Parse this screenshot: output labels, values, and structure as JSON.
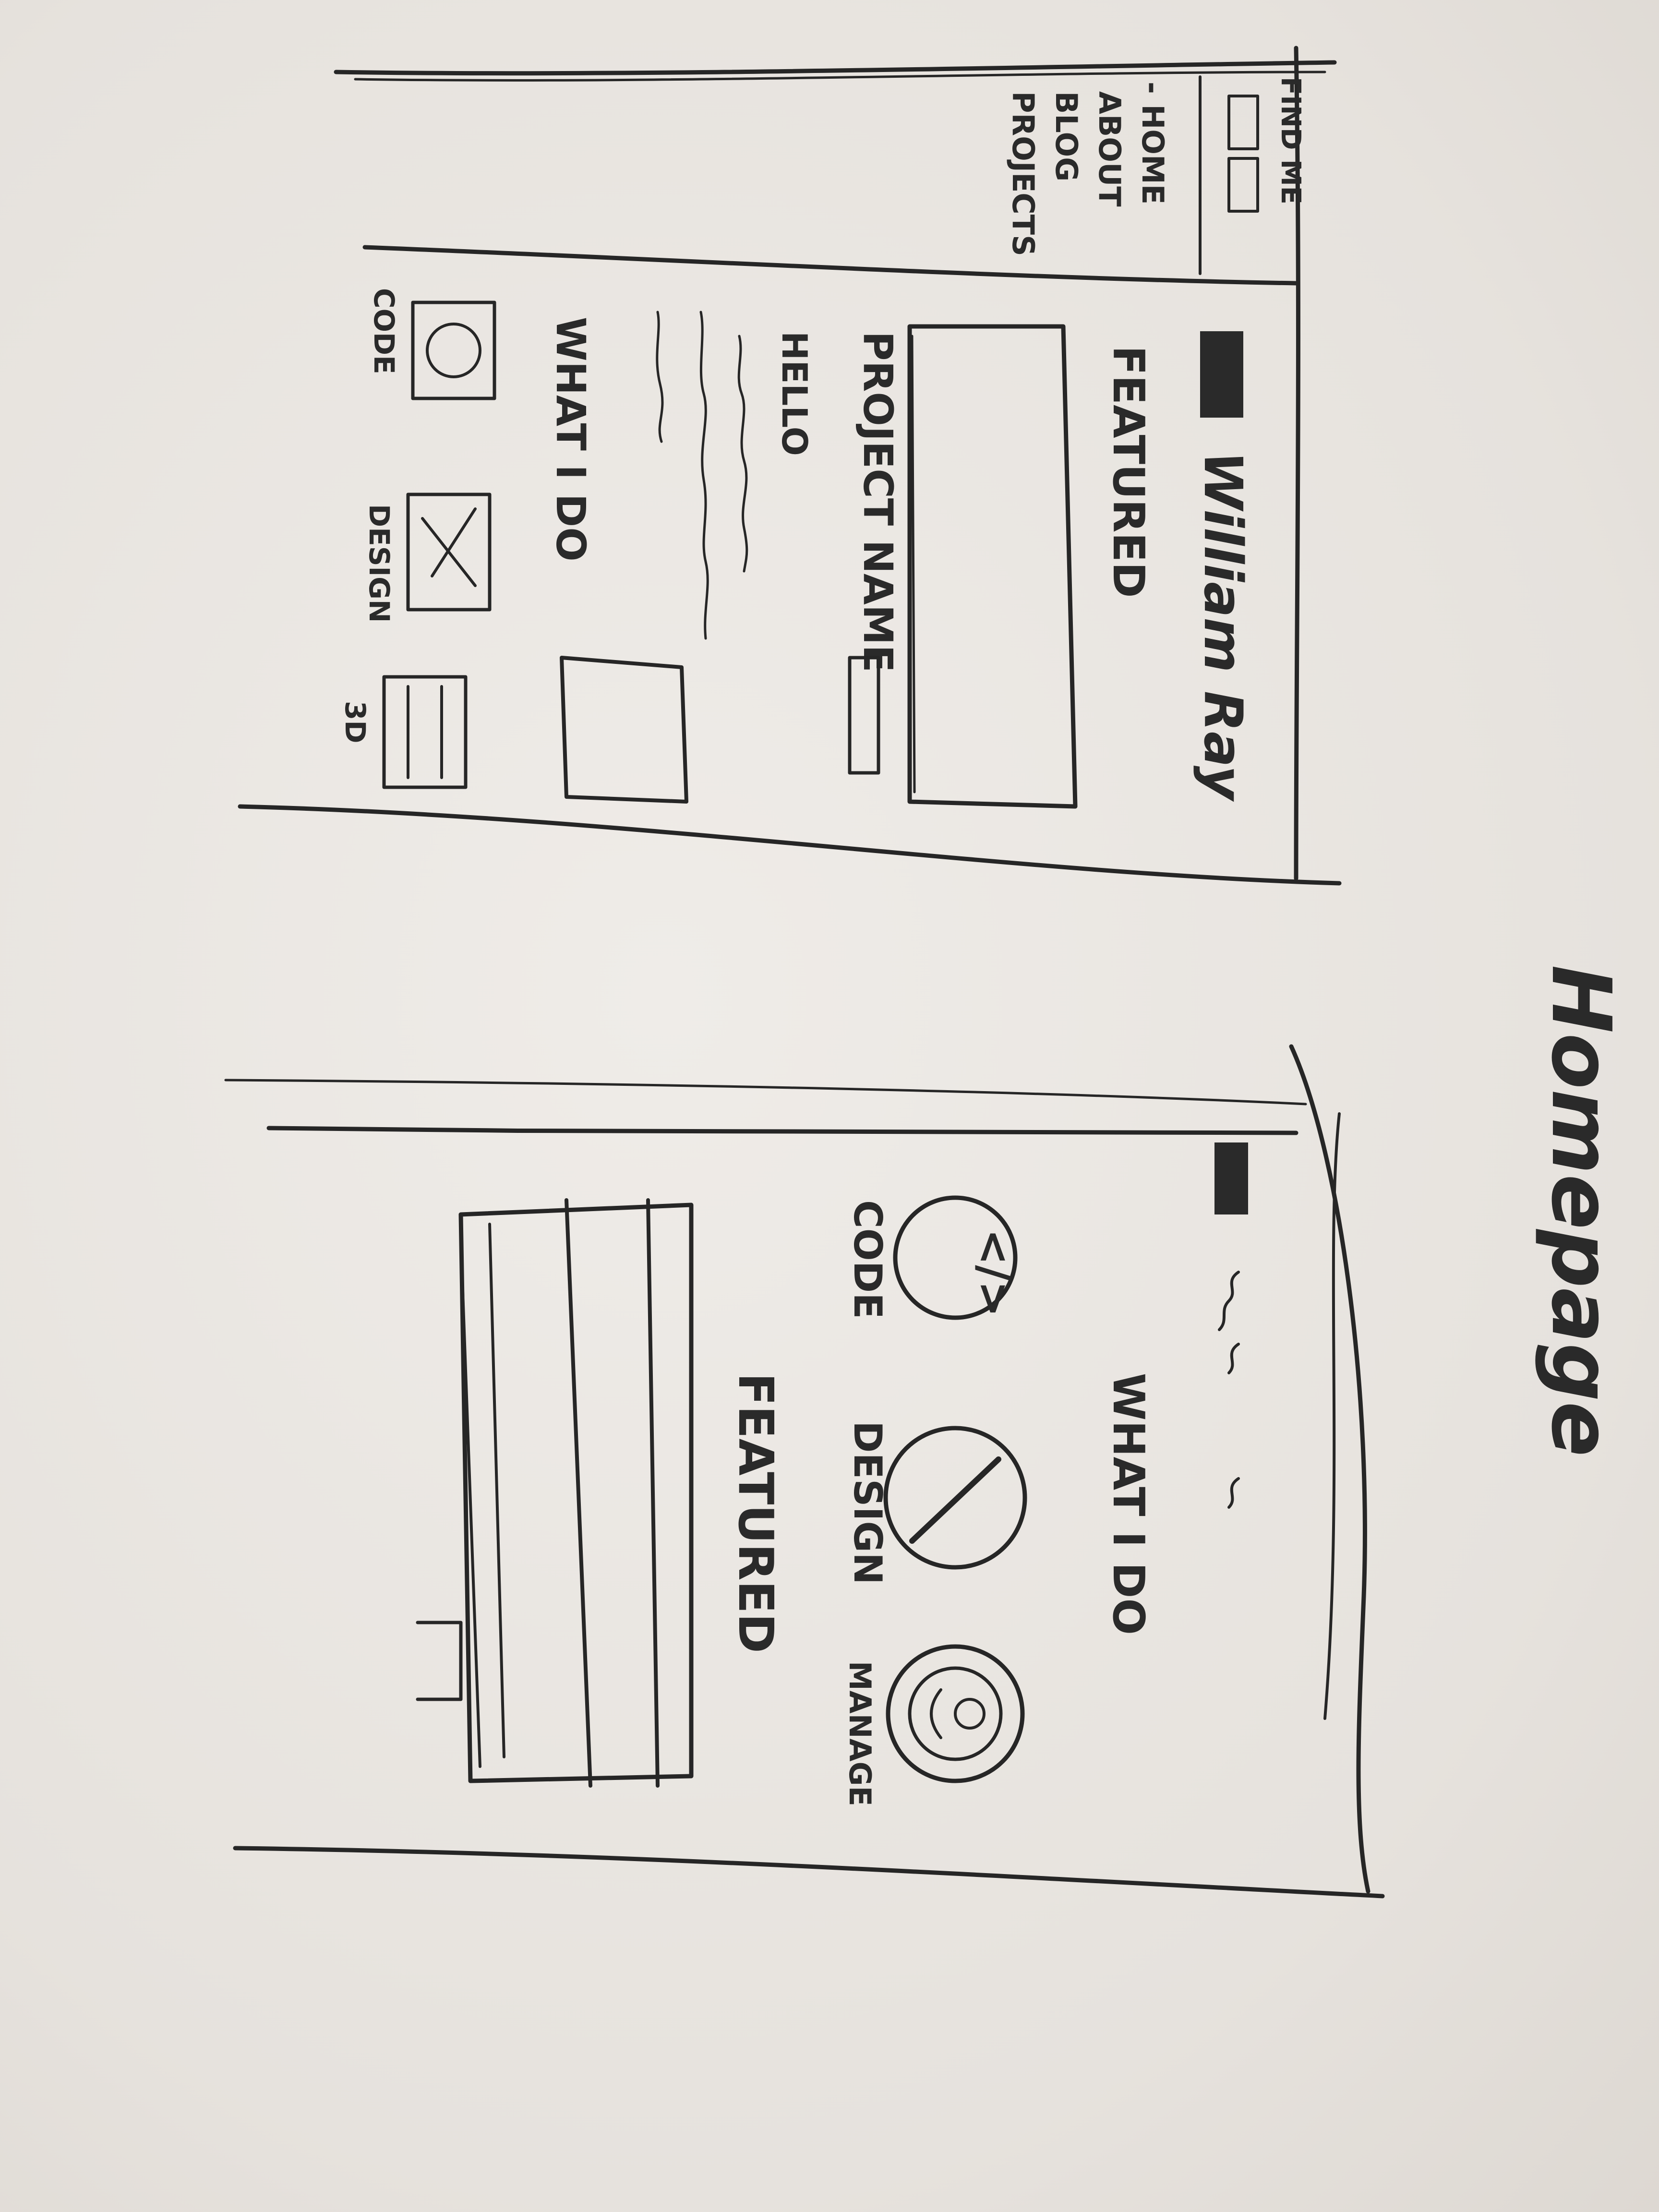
{
  "page_title": "Homepage",
  "desktop": {
    "logo_text": "FIND ME",
    "nav_items": [
      {
        "label": "- HOME"
      },
      {
        "label": "ABOUT"
      },
      {
        "label": "BLOG"
      },
      {
        "label": "PROJECTS"
      }
    ],
    "name_heading": "William Ray",
    "featured_label": "FEATURED",
    "project_name": "PROJECT NAME",
    "hello_label": "HELLO",
    "what_i_do_label": "WHAT I DO",
    "services": [
      {
        "label": "CODE",
        "icon": "code-icon"
      },
      {
        "label": "DESIGN",
        "icon": "pen-icon"
      },
      {
        "label": "3D",
        "icon": "cube-icon"
      }
    ]
  },
  "mobile": {
    "what_i_do_label": "WHAT I DO",
    "services": [
      {
        "label": "CODE",
        "icon": "code-icon",
        "glyph": "</>"
      },
      {
        "label": "DESIGN",
        "icon": "pen-icon"
      },
      {
        "label": "MANAGE",
        "icon": "person-icon"
      }
    ],
    "featured_label": "FEATURED"
  },
  "colors": {
    "paper": "#e9e6e2",
    "ink": "#262626"
  }
}
